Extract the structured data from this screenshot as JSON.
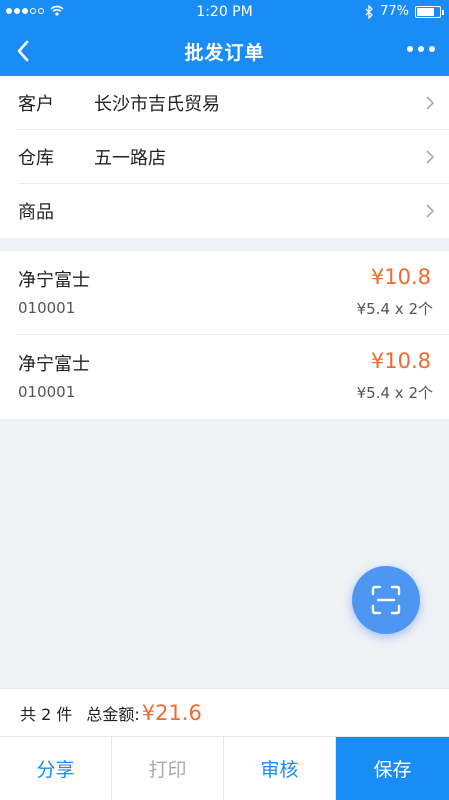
{
  "status_bar": {
    "time": "1:20 PM",
    "battery": "77%"
  },
  "nav": {
    "title": "批发订单"
  },
  "form": [
    {
      "label": "客户",
      "value": "长沙市吉氏贸易"
    },
    {
      "label": "仓库",
      "value": "五一路店"
    },
    {
      "label": "商品",
      "value": ""
    }
  ],
  "items": [
    {
      "name": "净宁富士",
      "code": "010001",
      "total": "¥10.8",
      "detail": "¥5.4 x 2个"
    },
    {
      "name": "净宁富士",
      "code": "010001",
      "total": "¥10.8",
      "detail": "¥5.4 x 2个"
    }
  ],
  "summary": {
    "count": "共 2 件",
    "amount_label": "总金额:",
    "amount": "¥21.6"
  },
  "actions": {
    "share": "分享",
    "print": "打印",
    "audit": "审核",
    "save": "保存"
  },
  "colors": {
    "primary": "#1a8cf5",
    "price": "#ee6a2f",
    "disabled": "#aaaaaa"
  }
}
